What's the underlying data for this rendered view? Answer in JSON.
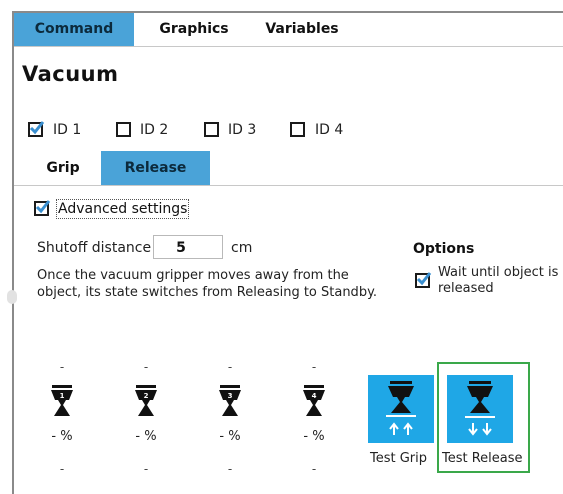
{
  "main_tabs": [
    {
      "label": "Command",
      "active": true
    },
    {
      "label": "Graphics",
      "active": false
    },
    {
      "label": "Variables",
      "active": false
    }
  ],
  "title": "Vacuum",
  "ids": [
    {
      "label": "ID 1",
      "checked": true
    },
    {
      "label": "ID 2",
      "checked": false
    },
    {
      "label": "ID 3",
      "checked": false
    },
    {
      "label": "ID 4",
      "checked": false
    }
  ],
  "sub_tabs": [
    {
      "label": "Grip",
      "active": false
    },
    {
      "label": "Release",
      "active": true
    }
  ],
  "advanced": {
    "label": "Advanced settings",
    "checked": true
  },
  "shutoff": {
    "label": "Shutoff distance",
    "value": "5",
    "unit": "cm",
    "description_line1": "Once the vacuum gripper moves away from the",
    "description_line2": "object, its state switches from Releasing to Standby."
  },
  "options": {
    "title": "Options",
    "wait_line1": "Wait until object is",
    "wait_line2": "released",
    "wait_checked": true
  },
  "grippers": [
    {
      "number": "1",
      "top": "-",
      "percent": "- %",
      "bottom": "-"
    },
    {
      "number": "2",
      "top": "-",
      "percent": "- %",
      "bottom": "-"
    },
    {
      "number": "3",
      "top": "-",
      "percent": "- %",
      "bottom": "-"
    },
    {
      "number": "4",
      "top": "-",
      "percent": "- %",
      "bottom": "-"
    }
  ],
  "test_grip": {
    "label": "Test Grip"
  },
  "test_release": {
    "label": "Test Release"
  },
  "colors": {
    "accent": "#4aa3d8",
    "button": "#1fa7e6",
    "focus": "#3aa84a"
  }
}
